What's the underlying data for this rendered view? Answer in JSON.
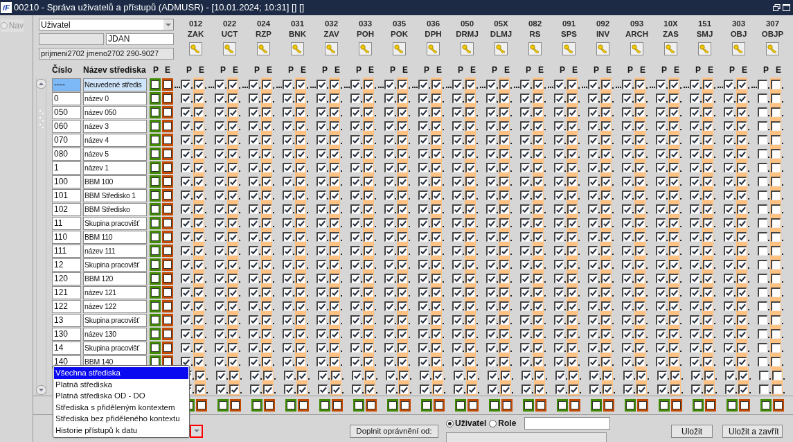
{
  "window": {
    "logo": "íF",
    "title": "00210 - Správa uživatelů a přístupů (ADMUSR) - [10.01.2024; 10:31] [] []"
  },
  "sidebar": {
    "label": "Nav",
    "selected": false
  },
  "filter": {
    "type_value": "Uživatel",
    "code_value": "JDAN",
    "person_value": "prijmeni2702 jmeno2702 290-9027"
  },
  "headers": {
    "number": "Číslo",
    "name": "Název střediska",
    "p": "P",
    "e": "E"
  },
  "columns": [
    {
      "number": "012",
      "code": "ZAK",
      "p_label": "P",
      "e_label": "E",
      "p_checked": true,
      "e_checked": true
    },
    {
      "number": "022",
      "code": "UCT",
      "p_label": "P",
      "e_label": "E",
      "p_checked": true,
      "e_checked": true
    },
    {
      "number": "024",
      "code": "RZP",
      "p_label": "P",
      "e_label": "E",
      "p_checked": true,
      "e_checked": true
    },
    {
      "number": "031",
      "code": "BNK",
      "p_label": "P",
      "e_label": "E",
      "p_checked": true,
      "e_checked": true
    },
    {
      "number": "032",
      "code": "ZAV",
      "p_label": "P",
      "e_label": "E",
      "p_checked": true,
      "e_checked": true
    },
    {
      "number": "033",
      "code": "POH",
      "p_label": "P",
      "e_label": "E",
      "p_checked": true,
      "e_checked": true
    },
    {
      "number": "035",
      "code": "POK",
      "p_label": "P",
      "e_label": "E",
      "p_checked": true,
      "e_checked": true
    },
    {
      "number": "036",
      "code": "DPH",
      "p_label": "P",
      "e_label": "E",
      "p_checked": true,
      "e_checked": true
    },
    {
      "number": "050",
      "code": "DRMJ",
      "p_label": "P",
      "e_label": "E",
      "p_checked": true,
      "e_checked": true
    },
    {
      "number": "05X",
      "code": "DLMJ",
      "p_label": "P",
      "e_label": "E",
      "p_checked": true,
      "e_checked": true
    },
    {
      "number": "082",
      "code": "RS",
      "p_label": "P",
      "e_label": "E",
      "p_checked": true,
      "e_checked": true
    },
    {
      "number": "091",
      "code": "SPS",
      "p_label": "P",
      "e_label": "E",
      "p_checked": true,
      "e_checked": true
    },
    {
      "number": "092",
      "code": "INV",
      "p_label": "P",
      "e_label": "E",
      "p_checked": true,
      "e_checked": true
    },
    {
      "number": "093",
      "code": "ARCH",
      "p_label": "P",
      "e_label": "E",
      "p_checked": true,
      "e_checked": true
    },
    {
      "number": "10X",
      "code": "ZAS",
      "p_label": "P",
      "e_label": "E",
      "p_checked": true,
      "e_checked": true
    },
    {
      "number": "151",
      "code": "SMJ",
      "p_label": "P",
      "e_label": "E",
      "p_checked": true,
      "e_checked": true
    },
    {
      "number": "303",
      "code": "OBJ",
      "p_label": "P",
      "e_label": "E",
      "p_checked": true,
      "e_checked": true
    },
    {
      "number": "307",
      "code": "OBJP",
      "p_label": "P",
      "e_label": "E",
      "p_checked": false,
      "e_checked": false
    }
  ],
  "rows": [
    {
      "cislo": "----",
      "name": "Neuvedené středis",
      "selected": true,
      "p": false,
      "e": false
    },
    {
      "cislo": "0",
      "name": "název 0",
      "selected": false,
      "p": false,
      "e": false
    },
    {
      "cislo": "050",
      "name": "název 050",
      "selected": false,
      "p": false,
      "e": false
    },
    {
      "cislo": "060",
      "name": "název 3",
      "selected": false,
      "p": false,
      "e": false
    },
    {
      "cislo": "070",
      "name": "název 4",
      "selected": false,
      "p": false,
      "e": false
    },
    {
      "cislo": "080",
      "name": "název 5",
      "selected": false,
      "p": false,
      "e": false
    },
    {
      "cislo": "1",
      "name": "název 1",
      "selected": false,
      "p": false,
      "e": false
    },
    {
      "cislo": "100",
      "name": "BBM 100",
      "selected": false,
      "p": false,
      "e": false
    },
    {
      "cislo": "101",
      "name": "BBM Středisko 1",
      "selected": false,
      "p": false,
      "e": false
    },
    {
      "cislo": "102",
      "name": "BBM Středisko",
      "selected": false,
      "p": false,
      "e": false
    },
    {
      "cislo": "11",
      "name": "Skupina pracovišť",
      "selected": false,
      "p": false,
      "e": false
    },
    {
      "cislo": "110",
      "name": "BBM 110",
      "selected": false,
      "p": false,
      "e": false
    },
    {
      "cislo": "111",
      "name": "název 111",
      "selected": false,
      "p": false,
      "e": false
    },
    {
      "cislo": "12",
      "name": "Skupina pracovišť",
      "selected": false,
      "p": false,
      "e": false
    },
    {
      "cislo": "120",
      "name": "BBM 120",
      "selected": false,
      "p": false,
      "e": false
    },
    {
      "cislo": "121",
      "name": "název 121",
      "selected": false,
      "p": false,
      "e": false
    },
    {
      "cislo": "122",
      "name": "název 122",
      "selected": false,
      "p": false,
      "e": false
    },
    {
      "cislo": "13",
      "name": "Skupina pracovišť",
      "selected": false,
      "p": false,
      "e": false
    },
    {
      "cislo": "130",
      "name": "název 130",
      "selected": false,
      "p": false,
      "e": false
    },
    {
      "cislo": "14",
      "name": "Skupina pracovišť",
      "selected": false,
      "p": false,
      "e": false
    },
    {
      "cislo": "140",
      "name": "BBM 140",
      "selected": false,
      "p": false,
      "e": false
    },
    {
      "kind": "covered"
    },
    {
      "kind": "covered"
    }
  ],
  "popup": {
    "items": [
      {
        "label": "Všechna střediska",
        "selected": true
      },
      {
        "label": "Platná střediska",
        "selected": false
      },
      {
        "label": "Platná střediska OD - DO",
        "selected": false
      },
      {
        "label": "Střediska s přiděleným kontextem",
        "selected": false
      },
      {
        "label": "Střediska bez přiděleného kontextu",
        "selected": false
      },
      {
        "label": "Historie přístupů k datu",
        "selected": false
      }
    ]
  },
  "bottom": {
    "fill_button": "Doplnit oprávnění od:",
    "radios": [
      {
        "label": "Uživatel",
        "selected": true
      },
      {
        "label": "Role",
        "selected": false
      }
    ],
    "buttons": [
      "Uložit",
      "Uložit a zavřít"
    ]
  }
}
